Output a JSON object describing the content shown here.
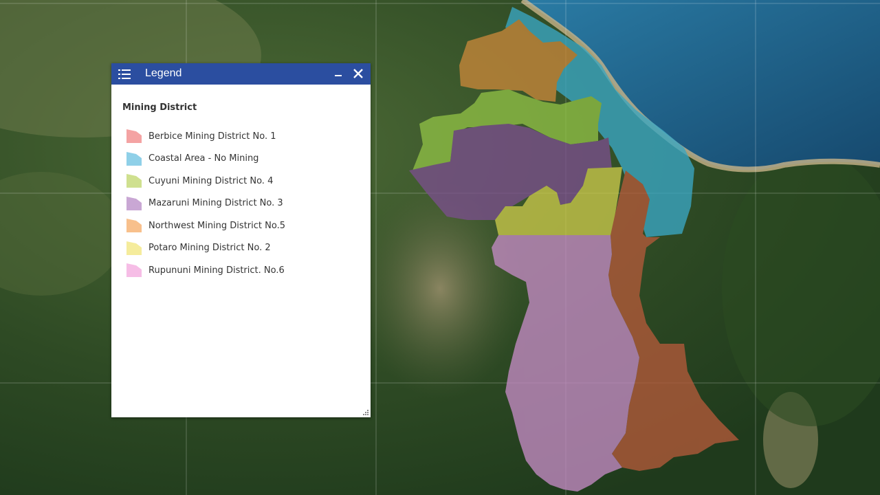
{
  "legend": {
    "title": "Legend",
    "layer_title": "Mining District",
    "items": [
      {
        "label": "Berbice Mining District No. 1",
        "color": "#f4a3a3"
      },
      {
        "label": "Coastal Area - No Mining",
        "color": "#8fd0e8"
      },
      {
        "label": "Cuyuni Mining District No. 4",
        "color": "#cfe08f"
      },
      {
        "label": "Mazaruni Mining District No. 3",
        "color": "#c9a7d4"
      },
      {
        "label": "Northwest Mining District No.5",
        "color": "#f8c08c"
      },
      {
        "label": "Potaro Mining District No. 2",
        "color": "#f5ec9c"
      },
      {
        "label": "Rupununi Mining District. No.6",
        "color": "#f6bde6"
      }
    ],
    "icons": {
      "header": "legend-list-icon",
      "minimize": "minimize-icon",
      "close": "close-icon",
      "resize": "resize-grip-icon"
    }
  },
  "map": {
    "region_colors": {
      "northwest": "#c7873a",
      "coastal": "#3aa7c4",
      "cuyuni": "#8fbf45",
      "mazaruni": "#7a4f8c",
      "potaro": "#c9c84a",
      "berbice": "#b35a3a",
      "rupununi": "#c48bc4"
    },
    "ocean_color": "#1f5c86"
  }
}
